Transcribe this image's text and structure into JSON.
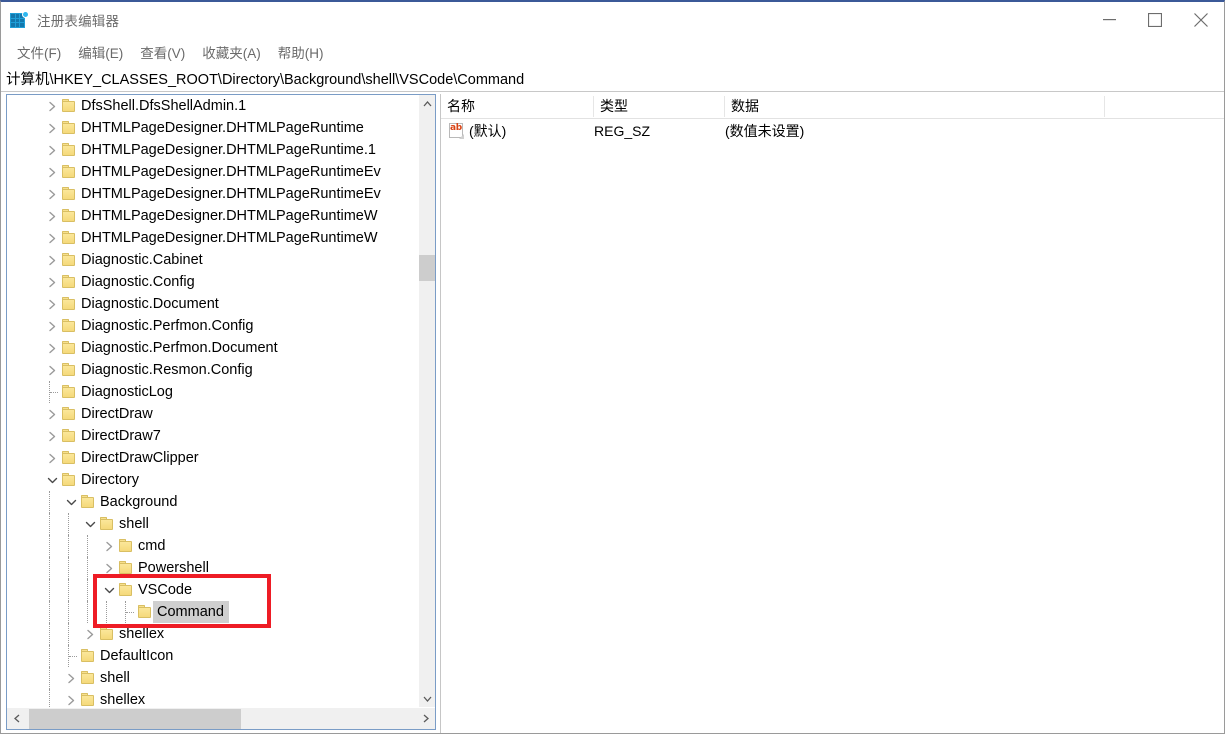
{
  "window": {
    "title": "注册表编辑器",
    "icon": "regedit-icon",
    "minimize_label": "最小化",
    "maximize_label": "最大化",
    "close_label": "关闭"
  },
  "menu": {
    "items": [
      {
        "label": "文件(F)"
      },
      {
        "label": "编辑(E)"
      },
      {
        "label": "查看(V)"
      },
      {
        "label": "收藏夹(A)"
      },
      {
        "label": "帮助(H)"
      }
    ]
  },
  "address": {
    "path": "计算机\\HKEY_CLASSES_ROOT\\Directory\\Background\\shell\\VSCode\\Command"
  },
  "tree": {
    "nodes": [
      {
        "label": "DfsShell.DfsShellAdmin.1",
        "depth": 1,
        "state": "collapsed"
      },
      {
        "label": "DHTMLPageDesigner.DHTMLPageRuntime",
        "depth": 1,
        "state": "collapsed"
      },
      {
        "label": "DHTMLPageDesigner.DHTMLPageRuntime.1",
        "depth": 1,
        "state": "collapsed"
      },
      {
        "label": "DHTMLPageDesigner.DHTMLPageRuntimeEv",
        "depth": 1,
        "state": "collapsed"
      },
      {
        "label": "DHTMLPageDesigner.DHTMLPageRuntimeEv",
        "depth": 1,
        "state": "collapsed"
      },
      {
        "label": "DHTMLPageDesigner.DHTMLPageRuntimeW",
        "depth": 1,
        "state": "collapsed"
      },
      {
        "label": "DHTMLPageDesigner.DHTMLPageRuntimeW",
        "depth": 1,
        "state": "collapsed"
      },
      {
        "label": "Diagnostic.Cabinet",
        "depth": 1,
        "state": "collapsed"
      },
      {
        "label": "Diagnostic.Config",
        "depth": 1,
        "state": "collapsed"
      },
      {
        "label": "Diagnostic.Document",
        "depth": 1,
        "state": "collapsed"
      },
      {
        "label": "Diagnostic.Perfmon.Config",
        "depth": 1,
        "state": "collapsed"
      },
      {
        "label": "Diagnostic.Perfmon.Document",
        "depth": 1,
        "state": "collapsed"
      },
      {
        "label": "Diagnostic.Resmon.Config",
        "depth": 1,
        "state": "collapsed"
      },
      {
        "label": "DiagnosticLog",
        "depth": 1,
        "state": "leaf"
      },
      {
        "label": "DirectDraw",
        "depth": 1,
        "state": "collapsed"
      },
      {
        "label": "DirectDraw7",
        "depth": 1,
        "state": "collapsed"
      },
      {
        "label": "DirectDrawClipper",
        "depth": 1,
        "state": "collapsed"
      },
      {
        "label": "Directory",
        "depth": 1,
        "state": "expanded"
      },
      {
        "label": "Background",
        "depth": 2,
        "state": "expanded"
      },
      {
        "label": "shell",
        "depth": 3,
        "state": "expanded"
      },
      {
        "label": "cmd",
        "depth": 4,
        "state": "collapsed"
      },
      {
        "label": "Powershell",
        "depth": 4,
        "state": "collapsed"
      },
      {
        "label": "VSCode",
        "depth": 4,
        "state": "expanded"
      },
      {
        "label": "Command",
        "depth": 5,
        "state": "leaf",
        "selected": true
      },
      {
        "label": "shellex",
        "depth": 3,
        "state": "collapsed"
      },
      {
        "label": "DefaultIcon",
        "depth": 2,
        "state": "leaf"
      },
      {
        "label": "shell",
        "depth": 2,
        "state": "collapsed"
      },
      {
        "label": "shellex",
        "depth": 2,
        "state": "collapsed"
      }
    ],
    "annotation": {
      "color": "#ee1c25",
      "covers": [
        "VSCode",
        "Command"
      ]
    },
    "vscroll": {
      "up_arrow": "▲",
      "down_arrow": "▼"
    },
    "hscroll": {
      "left_arrow": "◀",
      "right_arrow": "▶"
    }
  },
  "list": {
    "columns": [
      {
        "label": "名称"
      },
      {
        "label": "类型"
      },
      {
        "label": "数据"
      }
    ],
    "rows": [
      {
        "icon": "string-value-icon",
        "name": "(默认)",
        "type": "REG_SZ",
        "data": "(数值未设置)"
      }
    ]
  }
}
